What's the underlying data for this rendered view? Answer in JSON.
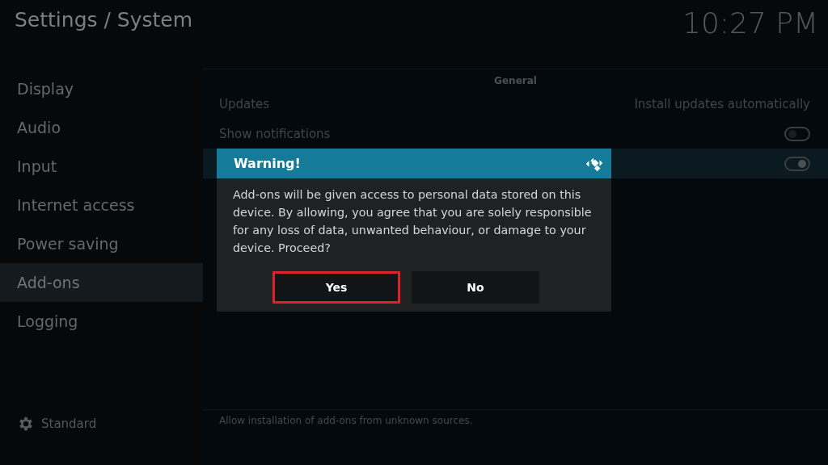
{
  "header": {
    "title": "Settings / System",
    "clock": "10:27 PM"
  },
  "sidebar": {
    "items": [
      {
        "label": "Display",
        "selected": false
      },
      {
        "label": "Audio",
        "selected": false
      },
      {
        "label": "Input",
        "selected": false
      },
      {
        "label": "Internet access",
        "selected": false
      },
      {
        "label": "Power saving",
        "selected": false
      },
      {
        "label": "Add-ons",
        "selected": true
      },
      {
        "label": "Logging",
        "selected": false
      }
    ],
    "level_label": "Standard"
  },
  "section": {
    "title": "General",
    "rows": [
      {
        "kind": "value",
        "label": "Updates",
        "value": "Install updates automatically",
        "selected": false
      },
      {
        "kind": "toggle",
        "label": "Show notifications",
        "on": false,
        "selected": false
      },
      {
        "kind": "toggle",
        "on": true,
        "selected": true
      }
    ],
    "description": "Allow installation of add-ons from unknown sources."
  },
  "dialog": {
    "title": "Warning!",
    "message": "Add-ons will be given access to personal data stored on this device. By allowing, you agree that you are solely responsible for any loss of data, unwanted behaviour, or damage to your device. Proceed?",
    "buttons": [
      {
        "label": "Yes",
        "selected": true
      },
      {
        "label": "No",
        "selected": false
      }
    ]
  }
}
